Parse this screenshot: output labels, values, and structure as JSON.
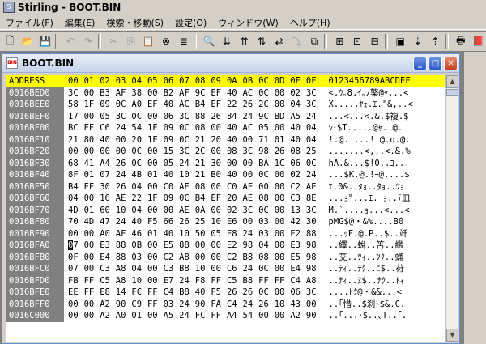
{
  "app": {
    "title": "Stirling - BOOT.BIN",
    "icon_label": "S"
  },
  "menu": [
    "ファイル(F)",
    "編集(E)",
    "検索・移動(S)",
    "設定(O)",
    "ウィンドウ(W)",
    "ヘルプ(H)"
  ],
  "toolbar": [
    {
      "name": "new-file-icon",
      "glyph": "🗋",
      "disabled": false
    },
    {
      "name": "open-file-icon",
      "glyph": "📂",
      "disabled": false
    },
    {
      "name": "save-icon",
      "glyph": "💾",
      "disabled": false
    },
    {
      "sep": true
    },
    {
      "name": "undo-icon",
      "glyph": "↶",
      "disabled": true
    },
    {
      "name": "redo-icon",
      "glyph": "↷",
      "disabled": true
    },
    {
      "sep": true
    },
    {
      "name": "cut-icon",
      "glyph": "✂",
      "disabled": true
    },
    {
      "name": "copy-icon",
      "glyph": "⎘",
      "disabled": true
    },
    {
      "name": "paste-icon",
      "glyph": "📋",
      "disabled": false
    },
    {
      "name": "delete-icon",
      "glyph": "⊗",
      "disabled": false
    },
    {
      "name": "list-icon",
      "glyph": "≣",
      "disabled": false
    },
    {
      "sep": true
    },
    {
      "name": "find-icon",
      "glyph": "🔍",
      "disabled": false
    },
    {
      "name": "find-next-icon",
      "glyph": "⇊",
      "disabled": false
    },
    {
      "name": "find-prev-icon",
      "glyph": "⇈",
      "disabled": false
    },
    {
      "name": "find-hex-icon",
      "glyph": "⇅",
      "disabled": false
    },
    {
      "name": "replace-icon",
      "glyph": "⇄",
      "disabled": false
    },
    {
      "name": "jump-icon",
      "glyph": "⤵",
      "disabled": true
    },
    {
      "name": "compare-icon",
      "glyph": "⧉",
      "disabled": false
    },
    {
      "sep": true
    },
    {
      "name": "bookmark-add-icon",
      "glyph": "⊞",
      "disabled": false
    },
    {
      "name": "bookmark-next-icon",
      "glyph": "⊡",
      "disabled": false
    },
    {
      "name": "bookmark-prev-icon",
      "glyph": "⊟",
      "disabled": false
    },
    {
      "sep": true
    },
    {
      "name": "mode-icon",
      "glyph": "▣",
      "disabled": false
    },
    {
      "name": "marker-down-icon",
      "glyph": "⇣",
      "disabled": false
    },
    {
      "name": "marker-up-icon",
      "glyph": "⇡",
      "disabled": false
    },
    {
      "sep": true
    },
    {
      "name": "print-icon",
      "glyph": "🖶",
      "disabled": false
    },
    {
      "name": "help-book-icon",
      "glyph": "📕",
      "disabled": false
    }
  ],
  "document": {
    "title": "BOOT.BIN",
    "icon_label": "BIN",
    "header": {
      "address": "ADDRESS",
      "columns": [
        "00",
        "01",
        "02",
        "03",
        "04",
        "05",
        "06",
        "07",
        "08",
        "09",
        "0A",
        "0B",
        "0C",
        "0D",
        "0E",
        "0F"
      ],
      "text": "0123456789ABCDEF"
    },
    "cursor": {
      "row": 13,
      "col": 0
    },
    "rows": [
      {
        "addr": "0016BED0",
        "bytes": [
          "3C",
          "00",
          "B3",
          "AF",
          "38",
          "00",
          "B2",
          "AF",
          "9C",
          "EF",
          "40",
          "AC",
          "0C",
          "00",
          "02",
          "3C"
        ],
        "text": "<.ｳ｡8.ｲ｡ﾉ檠@ｬ...<"
      },
      {
        "addr": "0016BEE0",
        "bytes": [
          "58",
          "1F",
          "09",
          "0C",
          "A0",
          "EF",
          "40",
          "AC",
          "B4",
          "EF",
          "22",
          "26",
          "2C",
          "00",
          "04",
          "3C"
        ],
        "text": "X.....ﾔｪ.ｴ.\"&,..<"
      },
      {
        "addr": "0016BEF0",
        "bytes": [
          "17",
          "00",
          "05",
          "3C",
          "0C",
          "00",
          "06",
          "3C",
          "88",
          "26",
          "84",
          "24",
          "9C",
          "BD",
          "A5",
          "24"
        ],
        "text": "...<...<.&.$複.$"
      },
      {
        "addr": "0016BF00",
        "bytes": [
          "BC",
          "EF",
          "C6",
          "24",
          "54",
          "1F",
          "09",
          "0C",
          "08",
          "00",
          "40",
          "AC",
          "05",
          "00",
          "40",
          "04"
        ],
        "text": "ｼ･$T.....@ｬ..@."
      },
      {
        "addr": "0016BF10",
        "bytes": [
          "21",
          "80",
          "40",
          "00",
          "20",
          "1F",
          "09",
          "0C",
          "21",
          "20",
          "40",
          "00",
          "71",
          "01",
          "40",
          "04"
        ],
        "text": "!.@. ...! @.q.@."
      },
      {
        "addr": "0016BF20",
        "bytes": [
          "00",
          "00",
          "00",
          "00",
          "0C",
          "00",
          "15",
          "3C",
          "2C",
          "00",
          "08",
          "3C",
          "98",
          "26",
          "08",
          "25"
        ],
        "text": ".......<,..<.&.%"
      },
      {
        "addr": "0016BF30",
        "bytes": [
          "68",
          "41",
          "A4",
          "26",
          "0C",
          "00",
          "05",
          "24",
          "21",
          "30",
          "00",
          "00",
          "BA",
          "1C",
          "06",
          "0C"
        ],
        "text": "hA.&...$!0..ｺ..."
      },
      {
        "addr": "0016BF40",
        "bytes": [
          "8F",
          "01",
          "07",
          "24",
          "4B",
          "01",
          "40",
          "10",
          "21",
          "B0",
          "40",
          "00",
          "0C",
          "00",
          "02",
          "24"
        ],
        "text": "...$K.@.!ｰ@....$"
      },
      {
        "addr": "0016BF50",
        "bytes": [
          "B4",
          "EF",
          "30",
          "26",
          "04",
          "00",
          "C0",
          "AE",
          "08",
          "00",
          "C0",
          "AE",
          "00",
          "00",
          "C2",
          "AE"
        ],
        "text": "ｴ.0&..ﾀｮ..ﾀｮ..ﾂｮ"
      },
      {
        "addr": "0016BF60",
        "bytes": [
          "04",
          "00",
          "16",
          "AE",
          "22",
          "1F",
          "09",
          "0C",
          "B4",
          "EF",
          "20",
          "AE",
          "08",
          "00",
          "C3",
          "8E"
        ],
        "text": "...ｮ\"...ｴ. ｮ..ﾃ皿"
      },
      {
        "addr": "0016BF70",
        "bytes": [
          "4D",
          "01",
          "60",
          "10",
          "04",
          "00",
          "00",
          "AE",
          "0A",
          "00",
          "02",
          "3C",
          "0C",
          "00",
          "13",
          "3C"
        ],
        "text": "M.`....ｮ...<...<"
      },
      {
        "addr": "0016BF80",
        "bytes": [
          "70",
          "4D",
          "47",
          "24",
          "40",
          "F5",
          "66",
          "26",
          "25",
          "10",
          "E6",
          "00",
          "03",
          "00",
          "42",
          "30"
        ],
        "text": "pMG$@・&%....B0"
      },
      {
        "addr": "0016BF90",
        "bytes": [
          "00",
          "00",
          "A0",
          "AF",
          "46",
          "01",
          "40",
          "10",
          "50",
          "05",
          "E8",
          "24",
          "03",
          "00",
          "E2",
          "88"
        ],
        "text": "...ｯF.@.P..$..竏"
      },
      {
        "addr": "0016BFA0",
        "bytes": [
          "07",
          "00",
          "E3",
          "88",
          "0B",
          "00",
          "E5",
          "88",
          "00",
          "00",
          "E2",
          "98",
          "04",
          "00",
          "E3",
          "98"
        ],
        "text": "..繹..蛻..笘..繿"
      },
      {
        "addr": "0016BFB0",
        "bytes": [
          "0F",
          "00",
          "E4",
          "88",
          "03",
          "00",
          "C2",
          "A8",
          "00",
          "00",
          "C2",
          "B8",
          "08",
          "00",
          "E5",
          "98"
        ],
        "text": "..艾..ﾂｨ..ﾂｸ..蛹"
      },
      {
        "addr": "0016BFC0",
        "bytes": [
          "07",
          "00",
          "C3",
          "A8",
          "04",
          "00",
          "C3",
          "B8",
          "10",
          "00",
          "C6",
          "24",
          "0C",
          "00",
          "E4",
          "98"
        ],
        "text": "..ﾃｨ..ﾃｸ..ﾆ$..苻"
      },
      {
        "addr": "0016BFD0",
        "bytes": [
          "FB",
          "FF",
          "C5",
          "A8",
          "10",
          "00",
          "E7",
          "24",
          "F8",
          "FF",
          "C5",
          "B8",
          "FF",
          "FF",
          "C4",
          "A8"
        ],
        "text": "..ﾅｨ..ﾇ$..ﾅｸ..ﾄｨ"
      },
      {
        "addr": "0016BFE0",
        "bytes": [
          "EE",
          "FF",
          "E8",
          "14",
          "FC",
          "FF",
          "C4",
          "B8",
          "40",
          "F5",
          "26",
          "26",
          "0C",
          "00",
          "06",
          "3C"
        ],
        "text": "....ﾄｸ@・&&...<"
      },
      {
        "addr": "0016BFF0",
        "bytes": [
          "00",
          "00",
          "A2",
          "90",
          "C9",
          "FF",
          "03",
          "24",
          "90",
          "FA",
          "C4",
          "24",
          "26",
          "10",
          "43",
          "00"
        ],
        "text": "..｢惜..$刹ﾄ$&.C."
      },
      {
        "addr": "0016C000",
        "bytes": [
          "00",
          "00",
          "A2",
          "A0",
          "01",
          "00",
          "A5",
          "24",
          "FC",
          "FF",
          "A4",
          "54",
          "00",
          "00",
          "A2",
          "90"
        ],
        "text": "..｢...･$..､T..｢."
      }
    ]
  }
}
